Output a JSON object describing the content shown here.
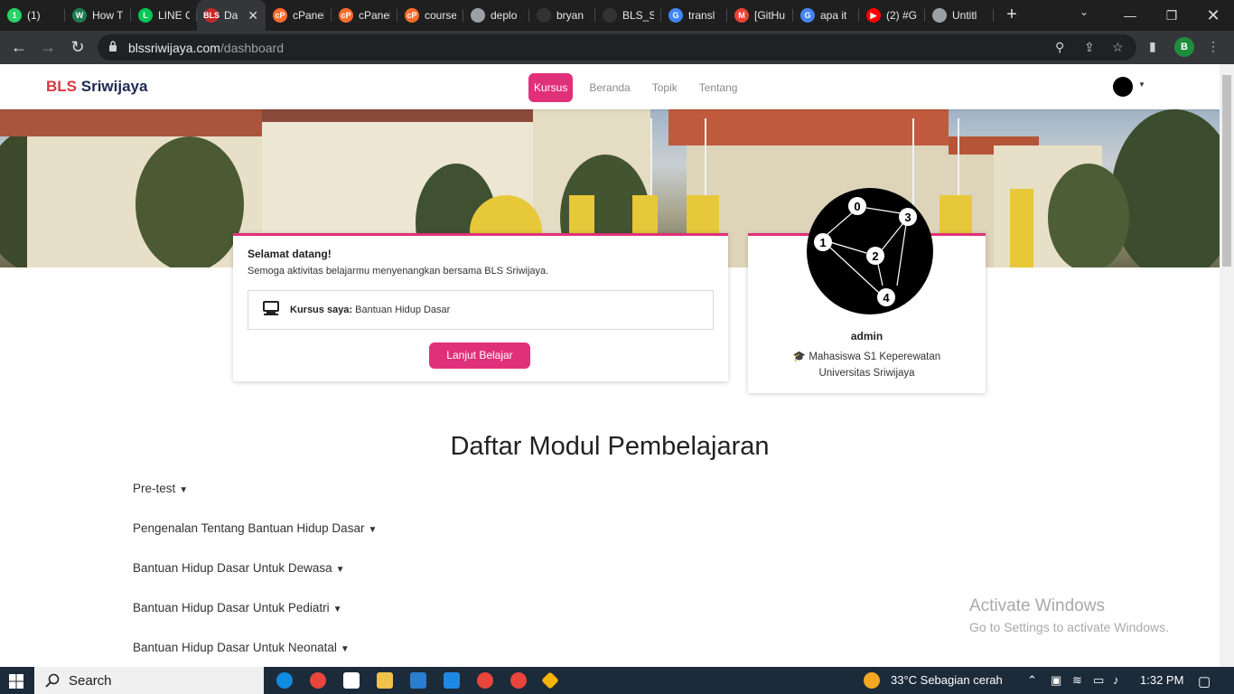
{
  "browser": {
    "tabs": [
      {
        "label": "(1)",
        "icon": "whatsapp-icon",
        "color": "#25d366",
        "badge": "1"
      },
      {
        "label": "How T",
        "icon": "w-icon",
        "color": "#1e7d4f",
        "badge": "W"
      },
      {
        "label": "LINE C",
        "icon": "line-icon",
        "color": "#06c755",
        "badge": "L"
      },
      {
        "label": "Da",
        "icon": "bls-icon",
        "color": "#c62828",
        "badge": "BLS",
        "active": true
      },
      {
        "label": "cPanel",
        "icon": "cpanel-icon",
        "color": "#ff6c2c",
        "badge": "cP"
      },
      {
        "label": "cPanel",
        "icon": "cpanel-icon",
        "color": "#ff6c2c",
        "badge": "cP"
      },
      {
        "label": "course",
        "icon": "cpanel-icon",
        "color": "#ff6c2c",
        "badge": "cP"
      },
      {
        "label": "deplo",
        "icon": "globe-icon",
        "color": "#9aa0a6",
        "badge": ""
      },
      {
        "label": "bryan",
        "icon": "github-icon",
        "color": "#333333",
        "badge": ""
      },
      {
        "label": "BLS_S",
        "icon": "github-icon",
        "color": "#333333",
        "badge": ""
      },
      {
        "label": "transl",
        "icon": "google-icon",
        "color": "#4285f4",
        "badge": "G"
      },
      {
        "label": "[GitHu",
        "icon": "gmail-icon",
        "color": "#ea4335",
        "badge": "M"
      },
      {
        "label": "apa it",
        "icon": "google-icon",
        "color": "#4285f4",
        "badge": "G"
      },
      {
        "label": "(2) #G",
        "icon": "youtube-icon",
        "color": "#ff0000",
        "badge": "▶"
      },
      {
        "label": "Untitl",
        "icon": "globe-icon",
        "color": "#9aa0a6",
        "badge": ""
      }
    ],
    "url_host": "blssriwijaya.com",
    "url_path": "/dashboard",
    "profile_initial": "B"
  },
  "navbar": {
    "brand_a": "BLS",
    "brand_b": "Sriwijaya",
    "menu": [
      "Kursus",
      "Beranda",
      "Topik",
      "Tentang"
    ]
  },
  "welcome": {
    "title": "Selamat datang!",
    "subtitle": "Semoga aktivitas belajarmu menyenangkan bersama BLS Sriwijaya.",
    "course_label": "Kursus saya:",
    "course_name": "Bantuan Hidup Dasar",
    "button": "Lanjut Belajar"
  },
  "profile": {
    "name": "admin",
    "role_line1": "Mahasiswa S1 Keperewatan",
    "role_line2": "Universitas Sriwijaya"
  },
  "modules": {
    "title": "Daftar Modul Pembelajaran",
    "items": [
      "Pre-test",
      "Pengenalan Tentang Bantuan Hidup Dasar",
      "Bantuan Hidup Dasar Untuk Dewasa",
      "Bantuan Hidup Dasar Untuk Pediatri",
      "Bantuan Hidup Dasar Untuk Neonatal"
    ]
  },
  "watermark": {
    "line1": "Activate Windows",
    "line2": "Go to Settings to activate Windows."
  },
  "taskbar": {
    "search": "Search",
    "weather": "33°C  Sebagian cerah",
    "time": "1:32 PM"
  },
  "diagram_labels": [
    "0",
    "1",
    "2",
    "3",
    "4"
  ]
}
